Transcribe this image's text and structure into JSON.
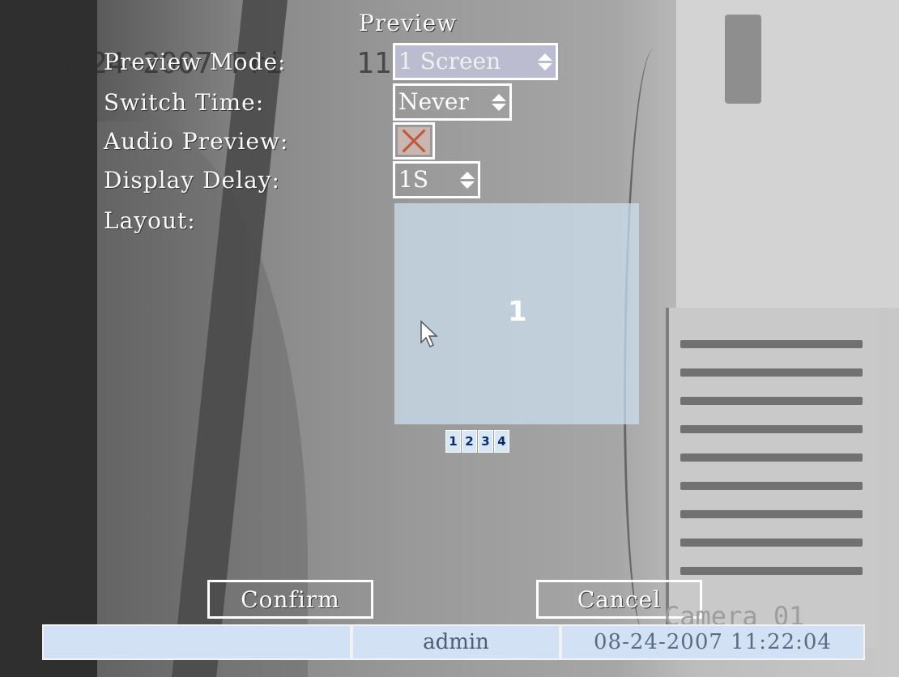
{
  "window": {
    "title": "Preview"
  },
  "overlay": {
    "timestamp_left": "08-24-2007 Fri",
    "timestamp_time": "11:22:04"
  },
  "form": {
    "preview_mode": {
      "label": "Preview Mode:",
      "value": "1 Screen"
    },
    "switch_time": {
      "label": "Switch Time:",
      "value": "Never"
    },
    "audio_preview": {
      "label": "Audio Preview:",
      "checked": false
    },
    "display_delay": {
      "label": "Display Delay:",
      "value": "1S"
    },
    "layout": {
      "label": "Layout:",
      "window_number": "1",
      "tabs": [
        "1",
        "2",
        "3",
        "4"
      ]
    }
  },
  "buttons": {
    "confirm": "Confirm",
    "cancel": "Cancel"
  },
  "camera": {
    "label": "Camera 01"
  },
  "status_bar": {
    "left": "",
    "user": "admin",
    "datetime": "08-24-2007 11:22:04"
  }
}
